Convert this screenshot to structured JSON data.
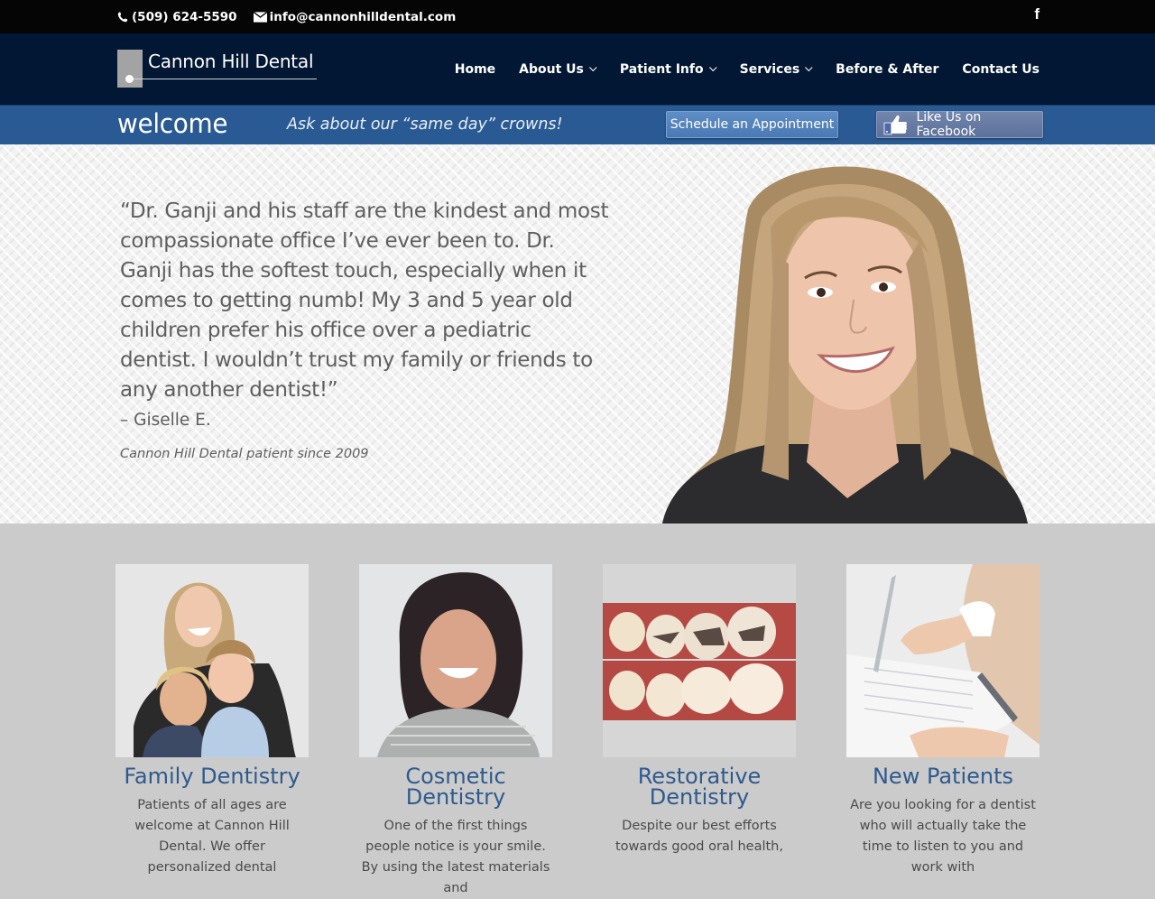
{
  "topbar": {
    "phone": "(509) 624-5590",
    "email": "info@cannonhilldental.com",
    "social_icon": "facebook-icon"
  },
  "header": {
    "logo_text": "Cannon Hill Dental",
    "nav": [
      {
        "label": "Home",
        "has_dropdown": false
      },
      {
        "label": "About Us",
        "has_dropdown": true
      },
      {
        "label": "Patient Info",
        "has_dropdown": true
      },
      {
        "label": "Services",
        "has_dropdown": true
      },
      {
        "label": "Before & After",
        "has_dropdown": false
      },
      {
        "label": "Contact Us",
        "has_dropdown": false
      }
    ]
  },
  "welcome_bar": {
    "title": "welcome",
    "promo": "Ask about our “same day” crowns!",
    "schedule_button": "Schedule an Appointment",
    "facebook_button": "Like Us on Facebook"
  },
  "hero": {
    "quote": "“Dr. Ganji and his staff are the kindest and most compassionate office I’ve ever been to. Dr. Ganji has the softest touch, especially when it comes to getting numb! My 3 and 5 year old children prefer his office over a pediatric dentist. I wouldn’t trust my family or friends to any another dentist!”",
    "author": "– Giselle E.",
    "since": "Cannon Hill Dental patient since 2009"
  },
  "services": [
    {
      "title": "Family Dentistry",
      "text": "Patients of all ages are welcome at Cannon Hill Dental. We offer personalized dental",
      "image": "family-photo"
    },
    {
      "title": "Cosmetic Dentistry",
      "text": "One of the first things people notice is your smile. By using the latest materials and",
      "image": "woman-smiling-photo"
    },
    {
      "title": "Restorative Dentistry",
      "text": "Despite our best efforts towards good oral health,",
      "image": "teeth-fillings-photo"
    },
    {
      "title": "New Patients",
      "text": "Are you looking for a dentist who will actually take the time to listen to you and work with",
      "image": "patient-form-photo"
    }
  ],
  "colors": {
    "topbar_bg": "#050505",
    "header_bg": "#021733",
    "welcome_bg": "#2a5a94",
    "service_title": "#2e5a8e",
    "services_bg": "#cbcbcb"
  }
}
